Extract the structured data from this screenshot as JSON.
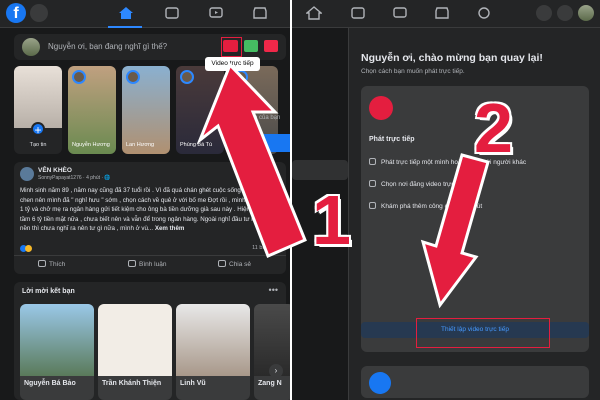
{
  "left": {
    "logo": "f",
    "composer_placeholder": "Nguyễn ơi, bạn đang nghĩ gì thế?",
    "tooltip": "Video trực tiếp",
    "create_story": "Tạo tin",
    "stories": [
      "Nguyễn Hương",
      "Lan Hương",
      "Phùng Bá Tú"
    ],
    "side_text": "n của bạn",
    "post": {
      "author": "VÊN KHÈO",
      "meta": "SonnyPapayat1276 · 4 phút · 🌐",
      "body": "Minh sinh năm 89 , năm nay cũng đã 37 tuổi rồi . Vì đã quá chán ghét cuộc sống đầu và bon chen nên mình đã \" nghỉ hưu \" sớm , chọn cách về quê ở với bố me Đợt rồi , mình biếu bố mẹ 1 tỷ và chở mẹ ra ngân hàng gửi tiết kiệm cho ông bà tiền dưỡng già sau này . Hiện tại mình có tầm 6 tỷ tiền mặt nữa , chưa biết nên và vẫn để trong ngân hàng. Ngoài nghỉ đầu tư mua đất nền thì chưa nghĩ ra nên tư gì nữa , mình ở vù...",
      "more": "Xem thêm",
      "comments": "11 bình luận",
      "actions": [
        "Thích",
        "Bình luận",
        "Chia sẻ"
      ]
    },
    "friends": {
      "title": "Lời mời kết bạn",
      "names": [
        "Nguyễn Bá Bảo",
        "Trần Khánh Thiện",
        "Linh Vũ",
        "Zang N"
      ]
    }
  },
  "right": {
    "welcome": "Nguyễn ơi, chào mừng bạn quay lại!",
    "welcome_sub": "Chọn cách bạn muốn phát trực tiếp.",
    "live_title": "Phát trực tiếp",
    "options": [
      "Phát trực tiếp một mình hoặc cùng với người khác",
      "Chọn nơi đăng video trực tiếp",
      "Khám phá thêm công cụ để thu hút"
    ],
    "setup_button": "Thiết lập video trực tiếp"
  },
  "annotations": {
    "num1": "1",
    "num2": "2"
  },
  "colors": {
    "accent": "#1877f2",
    "red": "#e41e3f",
    "bg": "#18191a",
    "card": "#242526"
  }
}
